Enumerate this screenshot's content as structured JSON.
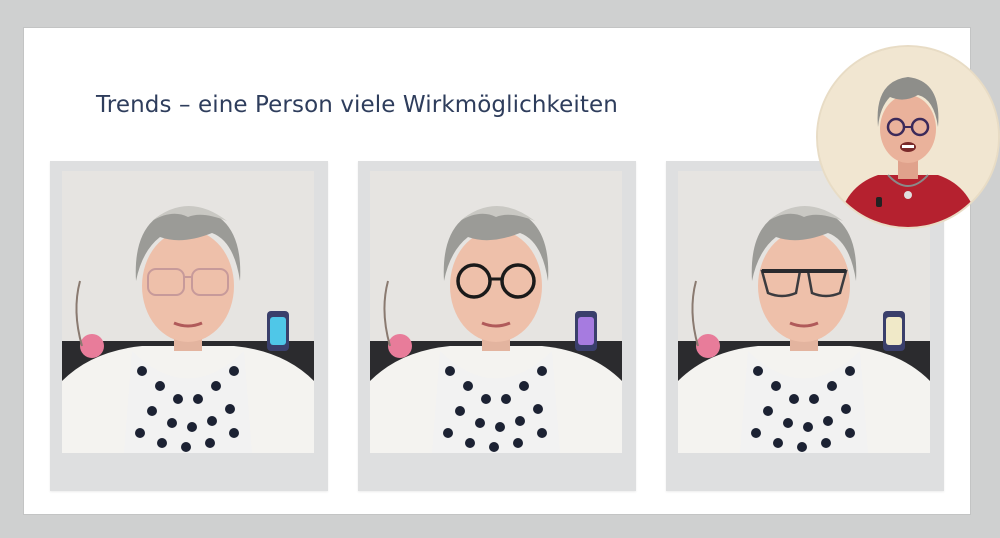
{
  "slide": {
    "title": "Trends – eine Person viele Wirkmöglichkeiten"
  },
  "photos": [
    {
      "glasses_style": "rimless-rectangular-rose"
    },
    {
      "glasses_style": "round-black-octagonal"
    },
    {
      "glasses_style": "dark-browline-cat-eye"
    }
  ],
  "presenter_webcam": {
    "glasses_style": "round-dark"
  },
  "colors": {
    "background": "#cfd0d0",
    "slide": "#ffffff",
    "title": "#2e3d5c",
    "frame": "#dedfe0",
    "webcam_bg": "#f1e6d1",
    "top_red": "#b5212f"
  }
}
